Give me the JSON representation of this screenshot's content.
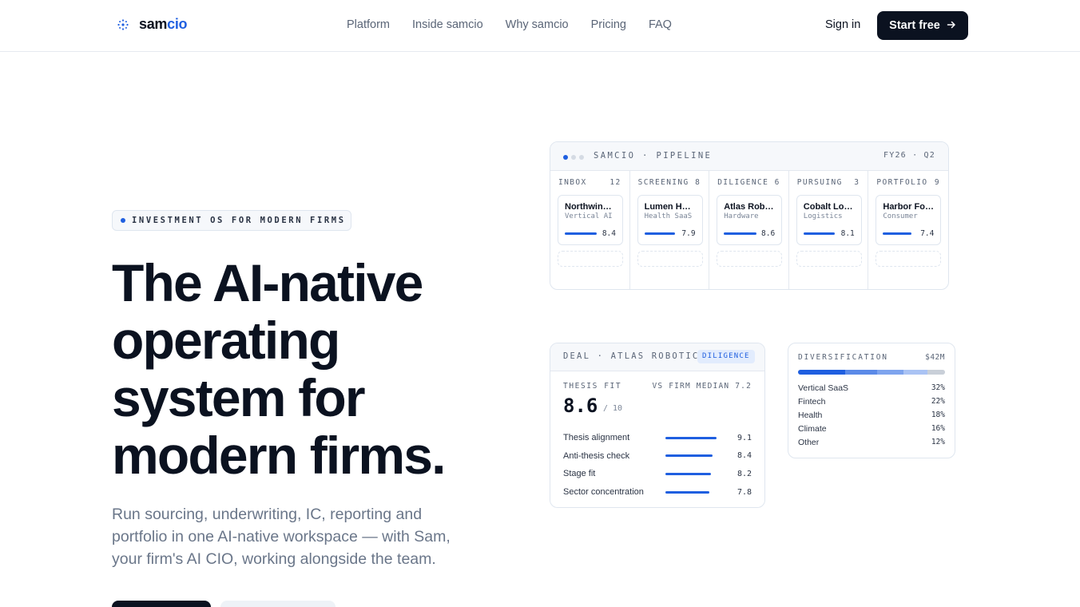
{
  "nav": {
    "logo_prefix": "sam",
    "logo_accent": "cio",
    "links": [
      "Platform",
      "Inside samcio",
      "Why samcio",
      "Pricing",
      "FAQ"
    ],
    "signin": "Sign in",
    "start": "Start free"
  },
  "hero": {
    "badge": "INVESTMENT OS FOR MODERN FIRMS",
    "headline": [
      "The AI-native",
      "operating",
      "system for",
      "modern firms."
    ],
    "subtitle": "Run sourcing, underwriting, IC, reporting and portfolio in one AI-native workspace — with Sam, your firm's AI CIO, working alongside the team."
  },
  "pipeline": {
    "title": "SAMCIO · PIPELINE",
    "period": "FY26 · Q2",
    "columns": [
      {
        "name": "INBOX",
        "count": "12",
        "deal": "Northwind ...",
        "sector": "Vertical AI",
        "score": "8.4",
        "fit": 0.84
      },
      {
        "name": "SCREENING",
        "count": "8",
        "deal": "Lumen Hea...",
        "sector": "Health SaaS",
        "score": "7.9",
        "fit": 0.79
      },
      {
        "name": "DILIGENCE",
        "count": "6",
        "deal": "Atlas Robo...",
        "sector": "Hardware",
        "score": "8.6",
        "fit": 0.86
      },
      {
        "name": "PURSUING",
        "count": "3",
        "deal": "Cobalt Log...",
        "sector": "Logistics",
        "score": "8.1",
        "fit": 0.81
      },
      {
        "name": "PORTFOLIO",
        "count": "9",
        "deal": "Harbor Foo...",
        "sector": "Consumer",
        "score": "7.4",
        "fit": 0.74
      }
    ]
  },
  "deal": {
    "title": "DEAL · ATLAS ROBOTICS",
    "stage": "DILIGENCE",
    "fit_label": "THESIS FIT",
    "median": "VS FIRM MEDIAN 7.2",
    "score": "8.6",
    "denom": "/ 10",
    "metrics": [
      {
        "label": "Thesis alignment",
        "value": "9.1",
        "fill": 0.91
      },
      {
        "label": "Anti-thesis check",
        "value": "8.4",
        "fill": 0.84
      },
      {
        "label": "Stage fit",
        "value": "8.2",
        "fill": 0.82
      },
      {
        "label": "Sector concentration",
        "value": "7.8",
        "fill": 0.78
      }
    ]
  },
  "diversification": {
    "title": "DIVERSIFICATION",
    "total": "$42M",
    "rows": [
      {
        "label": "Vertical SaaS",
        "pct": "32%",
        "share": 32,
        "color": "#1f5fe0"
      },
      {
        "label": "Fintech",
        "pct": "22%",
        "share": 22,
        "color": "#5b8ae8"
      },
      {
        "label": "Health",
        "pct": "18%",
        "share": 18,
        "color": "#7ea4ee"
      },
      {
        "label": "Climate",
        "pct": "16%",
        "share": 16,
        "color": "#aac3f4"
      },
      {
        "label": "Other",
        "pct": "12%",
        "share": 12,
        "color": "#c9cfd8"
      }
    ]
  },
  "colors": {
    "accent": "#1f5fe0",
    "ink": "#0b1220"
  }
}
